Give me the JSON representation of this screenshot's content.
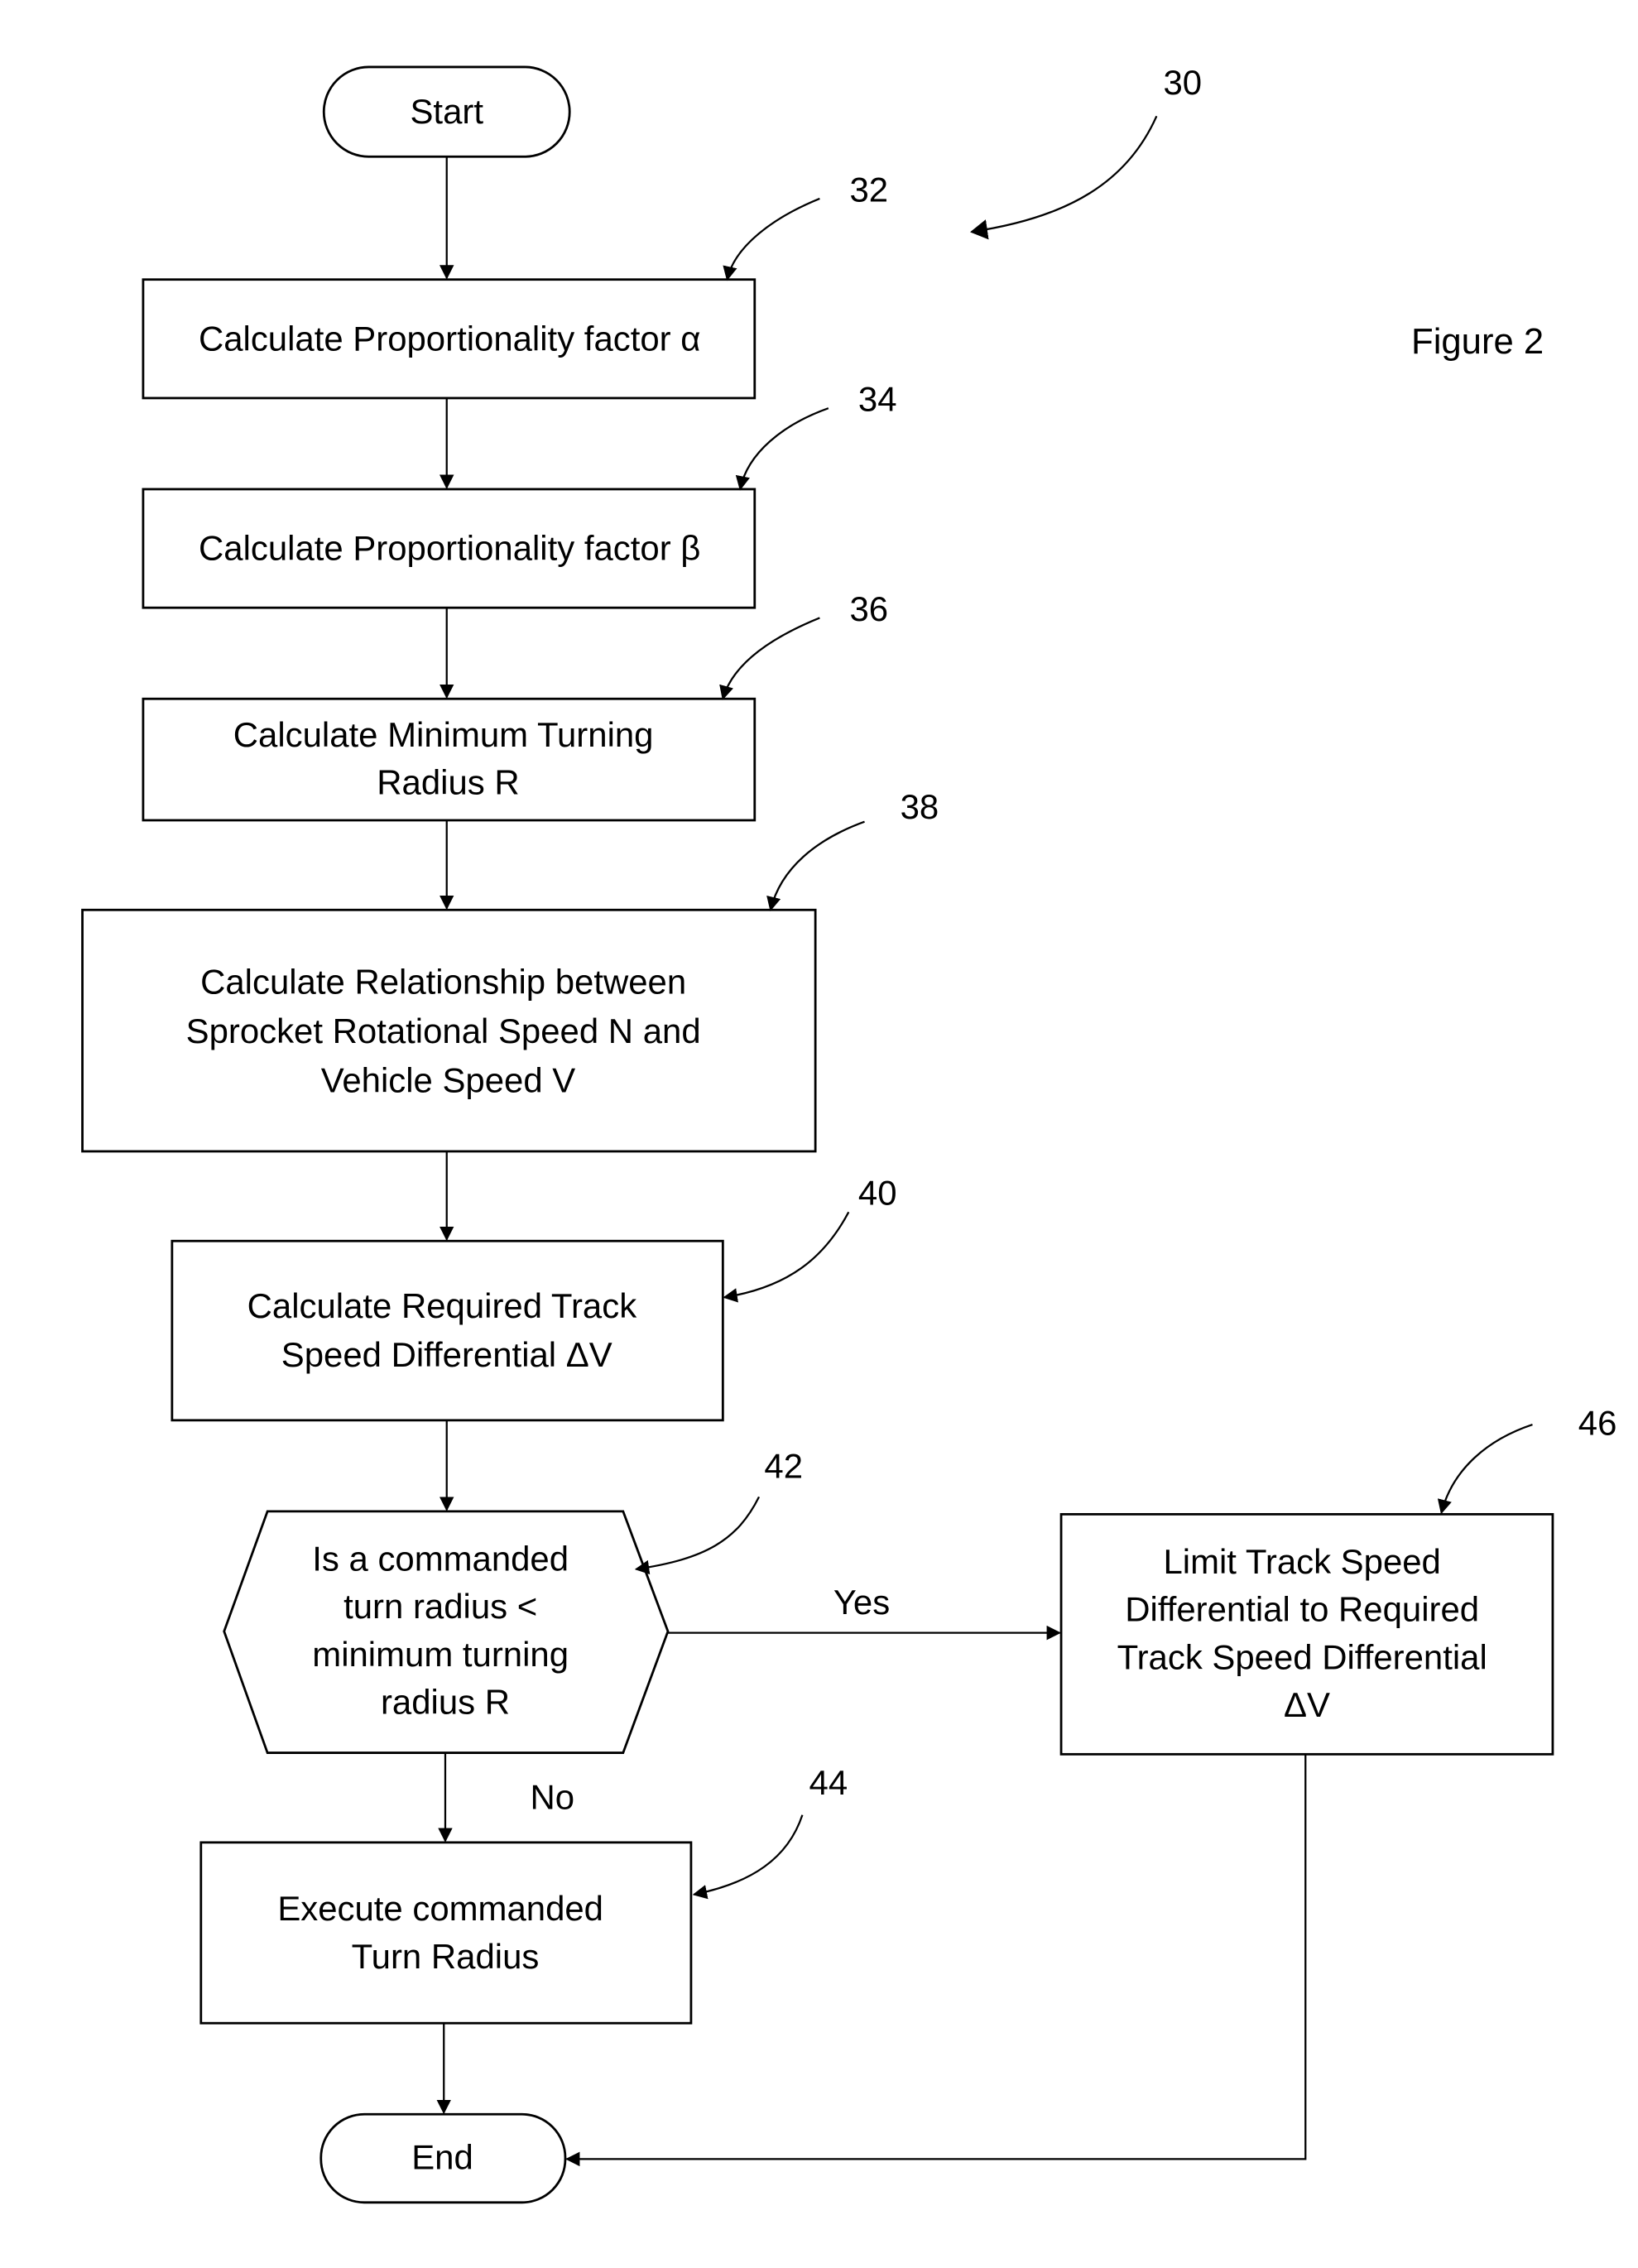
{
  "figure_label": "Figure 2",
  "diagram_ref": "30",
  "nodes": {
    "start": {
      "label": "Start"
    },
    "step32": {
      "ref": "32",
      "lines": [
        "Calculate Proportionality factor α"
      ]
    },
    "step34": {
      "ref": "34",
      "lines": [
        "Calculate Proportionality factor β"
      ]
    },
    "step36": {
      "ref": "36",
      "lines": [
        "Calculate Minimum Turning",
        "Radius R"
      ]
    },
    "step38": {
      "ref": "38",
      "lines": [
        "Calculate Relationship between",
        "Sprocket Rotational Speed N and",
        "Vehicle Speed V"
      ]
    },
    "step40": {
      "ref": "40",
      "lines": [
        "Calculate Required Track",
        "Speed Differential ΔV"
      ]
    },
    "decision42": {
      "ref": "42",
      "lines": [
        "Is a commanded",
        "turn radius <",
        "minimum turning",
        "radius R"
      ]
    },
    "step44": {
      "ref": "44",
      "lines": [
        "Execute commanded",
        "Turn Radius"
      ]
    },
    "step46": {
      "ref": "46",
      "lines": [
        "Limit Track Speed",
        "Differential to Required",
        "Track Speed Differential",
        "ΔV"
      ]
    },
    "end": {
      "label": "End"
    }
  },
  "edge_labels": {
    "yes": "Yes",
    "no": "No"
  }
}
